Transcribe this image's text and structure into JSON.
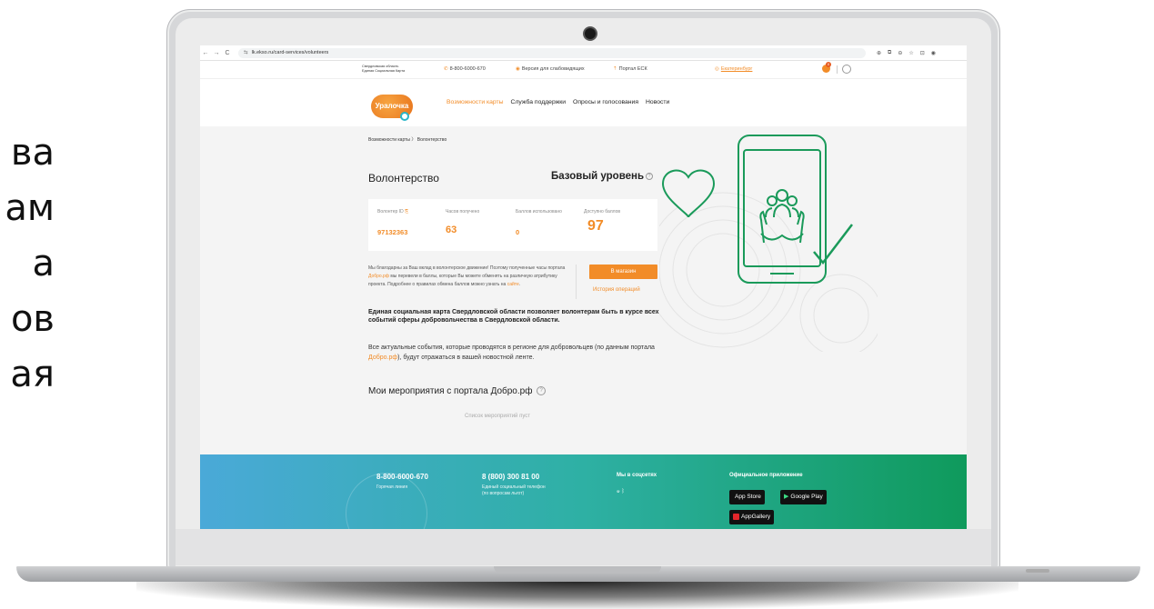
{
  "slide_text": [
    "ва",
    "ам",
    "а",
    "ов",
    "ая"
  ],
  "browser": {
    "back": "←",
    "forward": "→",
    "reload": "C",
    "tune": "⇆",
    "url": "lk.eksо.ru/card-services/volunteers",
    "icons": [
      "⊕",
      "⧉",
      "⊖",
      "☆",
      "⊡",
      "◉"
    ]
  },
  "site": {
    "region_line1": "Свердловская область",
    "region_line2": "Единая Социальная Карта",
    "phone": "8-800-6000-670",
    "accessibility": "Версия для слабовидящих",
    "portal": "Портал ЕСК",
    "city": "Екатеринбург",
    "cart_count": "0",
    "logo": "Уралочка",
    "menu": [
      "Возможности карты",
      "Служба поддержки",
      "Опросы и голосования",
      "Новости"
    ]
  },
  "page": {
    "breadcrumb": "Возможности карты  〉 Волонтерство",
    "title": "Волонтерство",
    "level": "Базовый уровень",
    "help_mark": "?",
    "stats": {
      "id_label": "Волонтер ID",
      "id_value": "97132363",
      "hours_label": "Часов получено",
      "hours_value": "63",
      "used_label": "Баллов использовано",
      "used_value": "0",
      "avail_label": "Доступно баллов",
      "avail_value": "97"
    },
    "info_1": "Мы благодарны за Ваш вклад в волонтерское движение! Поэтому полученные часы портала ",
    "info_link": "Добро.рф",
    "info_2": " мы перевели в баллы, которые Вы можете обменять на различную атрибутику проекта. Подробнее о правилах обмена баллов можно узнать на ",
    "info_link2": "сайте",
    "info_3": ".",
    "shop_button": "В магазин",
    "history_link": "История операций",
    "bold_text": "Единая социальная карта Свердловской области позволяет волонтерам быть в курсе всех событий сферы добровольчества в Свердловской области.",
    "reg_text_1": "Все актуальные события, которые проводятся в регионе для добровольцев (по данным портала ",
    "reg_text_link": "Добро.рф",
    "reg_text_2": "), будут отражаться в вашей новостной ленте.",
    "events_title": "Мои мероприятия с портала Добро.рф",
    "empty_list": "Список мероприятий пуст"
  },
  "footer": {
    "hotline_phone": "8-800-6000-670",
    "hotline_label": "Горячая линия",
    "social_phone": "8 (800) 300 81 00",
    "social_label_1": "Единый социальный телефон",
    "social_label_2": "(по вопросам льгот)",
    "social_head": "Мы в соцсетях",
    "social_icons": "☏   ᛒ",
    "apps_head": "Официальное приложение",
    "app_store": "App Store",
    "google_play": "Google Play",
    "app_gallery": "AppGallery"
  },
  "colors": {
    "accent": "#f28c28",
    "icon_green": "#1a9a5a"
  }
}
